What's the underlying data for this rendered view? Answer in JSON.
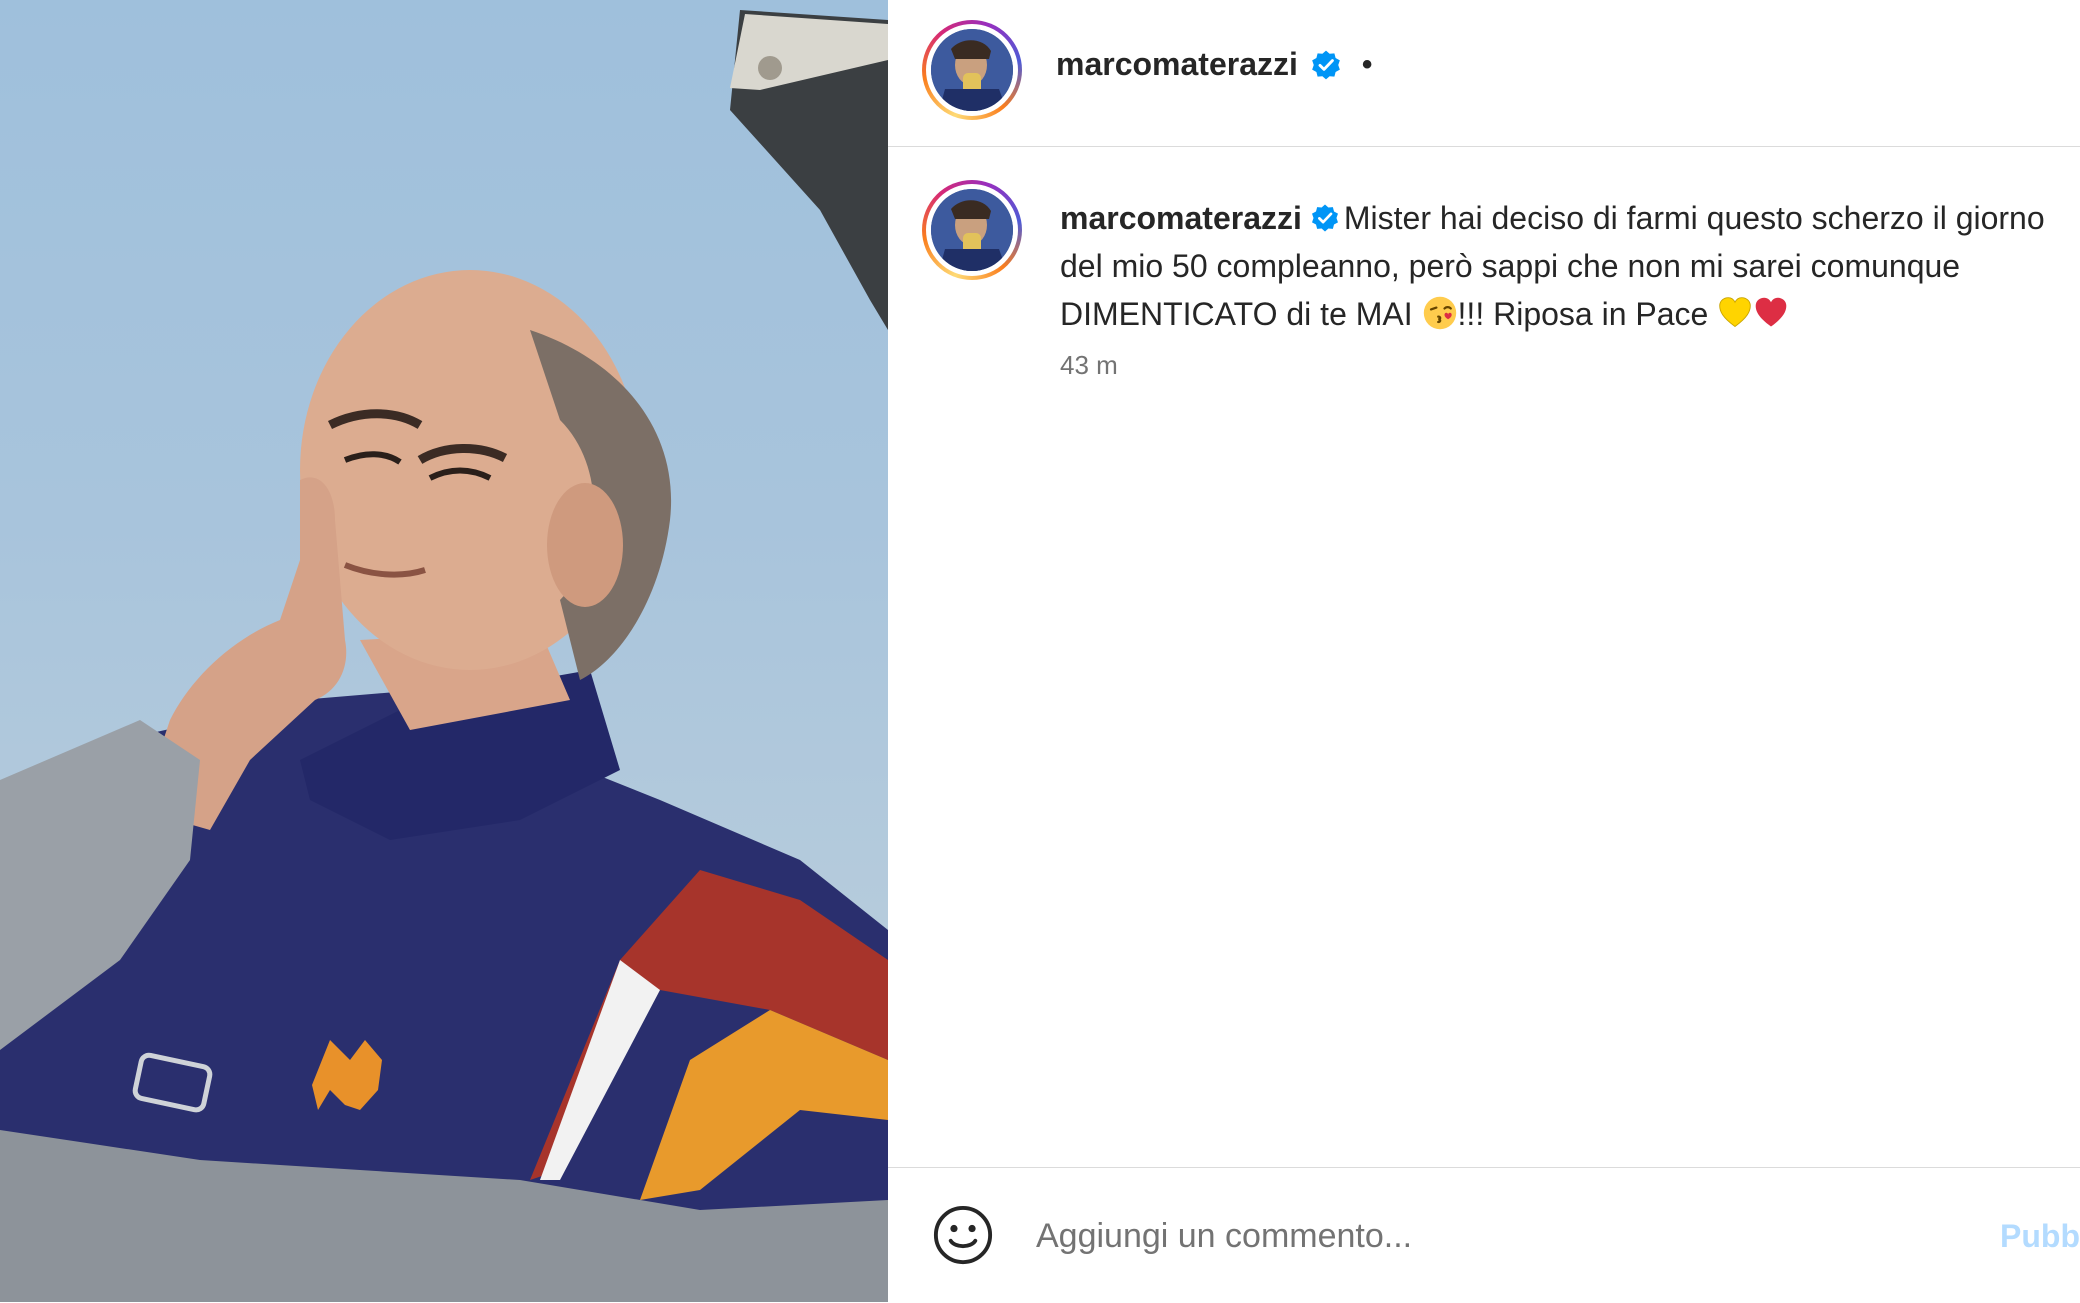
{
  "post": {
    "username": "marcomaterazzi",
    "verified": true,
    "header_separator": "•",
    "caption": {
      "part1": "Mister hai deciso di farmi questo scherzo il giorno del mio 50 compleanno, però sappi che non mi sarei comunque DIMENTICATO di te MAI ",
      "part2": "!!! Riposa in Pace ",
      "emojis": [
        "kissing-face-emoji",
        "yellow-heart-emoji",
        "red-heart-emoji"
      ]
    },
    "timestamp": "43 m"
  },
  "comment": {
    "placeholder": "Aggiungi un commento...",
    "publish_label": "Pubblica"
  },
  "colors": {
    "verified_blue": "#0095f6",
    "publish_disabled": "#b3dbff",
    "text": "#262626",
    "secondary_text": "#737373",
    "divider": "#dbdbdb"
  },
  "icons": [
    "verified-badge-icon",
    "emoji-smile-icon"
  ]
}
